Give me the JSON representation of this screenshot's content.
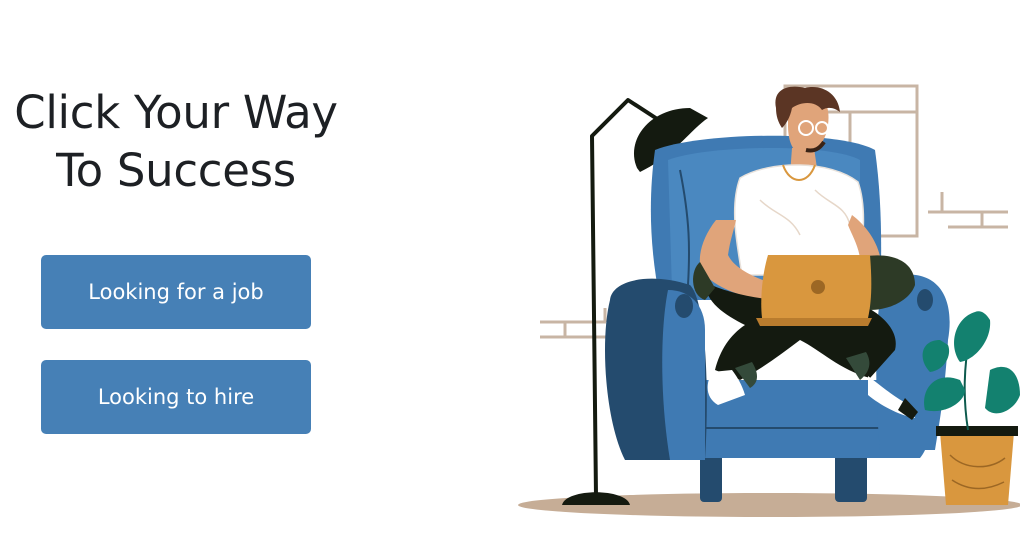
{
  "hero": {
    "title_line1": "Click Your Way",
    "title_line2": "To Success"
  },
  "actions": {
    "job_label": "Looking for a job",
    "hire_label": "Looking to hire"
  },
  "colors": {
    "button": "#4680b6",
    "button_text": "#ffffff",
    "title": "#1d2024",
    "chair": "#3f7ab3",
    "chair_dark": "#244b6e",
    "laptop": "#d9973e",
    "plant": "#13816f",
    "floor": "#c6ad96"
  },
  "illustration": {
    "subject": "person-sitting-in-armchair-with-laptop"
  }
}
